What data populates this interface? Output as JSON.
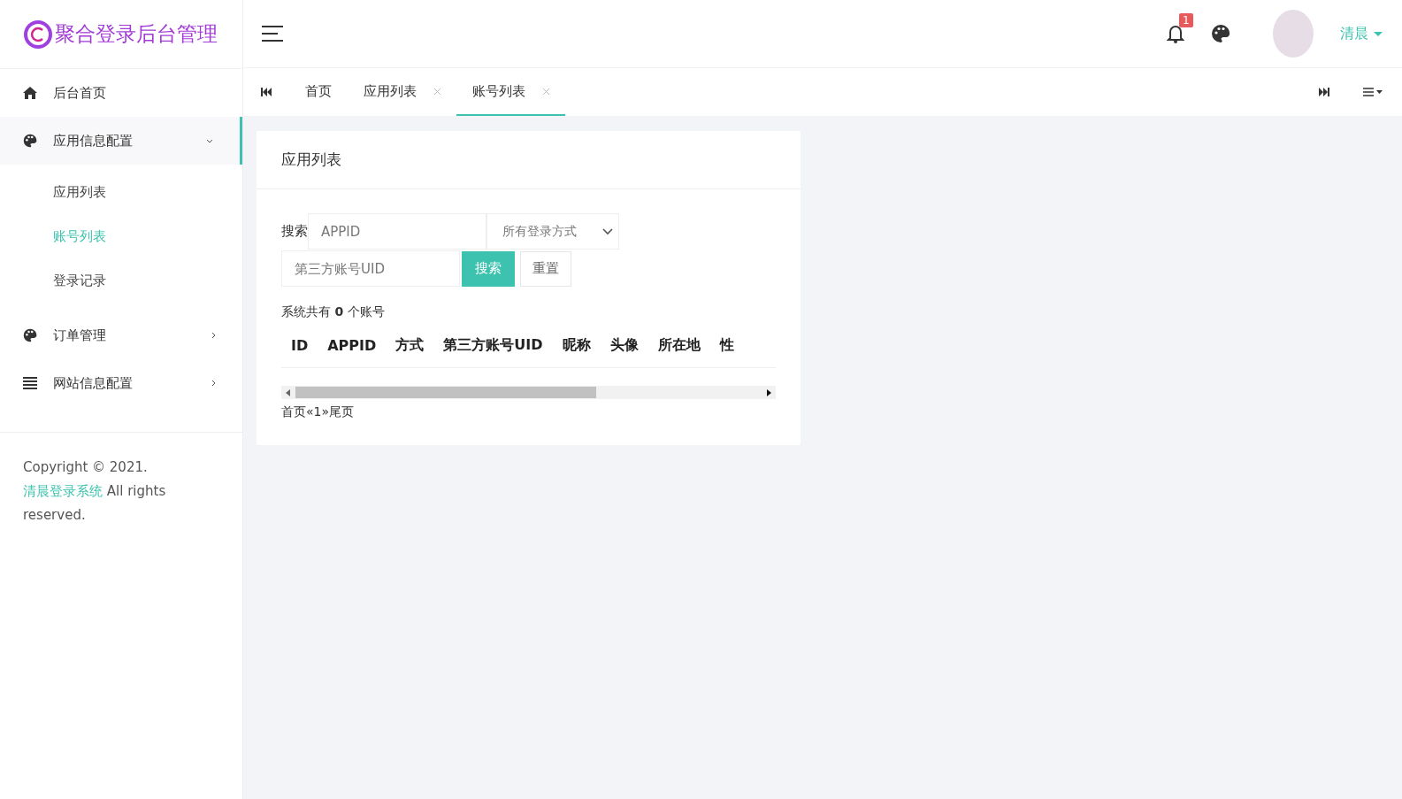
{
  "logo": {
    "text": "聚合登录后台管理"
  },
  "header": {
    "notifications": {
      "count": "1"
    },
    "user": {
      "name": "清晨"
    }
  },
  "sidebar": {
    "items": [
      {
        "label": "后台首页",
        "kind": "home",
        "selected": false
      },
      {
        "label": "应用信息配置",
        "kind": "palette",
        "selected": true,
        "expanded": true,
        "children": [
          {
            "label": "应用列表",
            "selected": false
          },
          {
            "label": "账号列表",
            "selected": true
          },
          {
            "label": "登录记录",
            "selected": false
          }
        ]
      },
      {
        "label": "订单管理",
        "kind": "palette",
        "selected": false,
        "expanded": false
      },
      {
        "label": "网站信息配置",
        "kind": "list",
        "selected": false,
        "expanded": false
      }
    ],
    "footer": {
      "text": "Copyright © 2021.",
      "link": "清晨登录系统",
      "suffix": "All rights reserved."
    }
  },
  "tabs": [
    {
      "label": "首页",
      "closable": false,
      "selected": false
    },
    {
      "label": "应用列表",
      "closable": true,
      "selected": false
    },
    {
      "label": "账号列表",
      "closable": true,
      "selected": true
    }
  ],
  "card": {
    "title": "应用列表",
    "search": {
      "label": "搜索",
      "appid_placeholder": "APPID",
      "method_select": "所有登录方式",
      "uid_placeholder": "第三方账号UID",
      "search_button": "搜索",
      "reset_button": "重置"
    },
    "summary": "系统共有 **0** 个账号",
    "table": {
      "columns": [
        "ID",
        "APPID",
        "方式",
        "第三方账号UID",
        "昵称",
        "头像",
        "所在地",
        "性"
      ]
    },
    "pagination": "首页«1»尾页"
  }
}
